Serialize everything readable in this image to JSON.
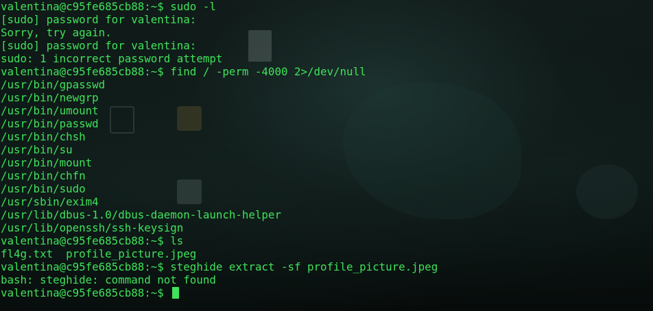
{
  "terminal": {
    "prompt": "valentina@c95fe685cb88:~$",
    "lines": [
      {
        "kind": "command",
        "text": "sudo -l"
      },
      {
        "kind": "output",
        "text": "[sudo] password for valentina:"
      },
      {
        "kind": "output",
        "text": "Sorry, try again."
      },
      {
        "kind": "output",
        "text": "[sudo] password for valentina:"
      },
      {
        "kind": "output",
        "text": "sudo: 1 incorrect password attempt"
      },
      {
        "kind": "command",
        "text": "find / -perm -4000 2>/dev/null"
      },
      {
        "kind": "output",
        "text": "/usr/bin/gpasswd"
      },
      {
        "kind": "output",
        "text": "/usr/bin/newgrp"
      },
      {
        "kind": "output",
        "text": "/usr/bin/umount"
      },
      {
        "kind": "output",
        "text": "/usr/bin/passwd"
      },
      {
        "kind": "output",
        "text": "/usr/bin/chsh"
      },
      {
        "kind": "output",
        "text": "/usr/bin/su"
      },
      {
        "kind": "output",
        "text": "/usr/bin/mount"
      },
      {
        "kind": "output",
        "text": "/usr/bin/chfn"
      },
      {
        "kind": "output",
        "text": "/usr/bin/sudo"
      },
      {
        "kind": "output",
        "text": "/usr/sbin/exim4"
      },
      {
        "kind": "output",
        "text": "/usr/lib/dbus-1.0/dbus-daemon-launch-helper"
      },
      {
        "kind": "output",
        "text": "/usr/lib/openssh/ssh-keysign"
      },
      {
        "kind": "command",
        "text": "ls"
      },
      {
        "kind": "output",
        "text": "fl4g.txt  profile_picture.jpeg"
      },
      {
        "kind": "command",
        "text": "steghide extract -sf profile_picture.jpeg"
      },
      {
        "kind": "output",
        "text": "bash: steghide: command not found"
      },
      {
        "kind": "active",
        "text": ""
      }
    ]
  },
  "colors": {
    "terminal_text": "#3fe35a",
    "background": "#0b1210"
  }
}
